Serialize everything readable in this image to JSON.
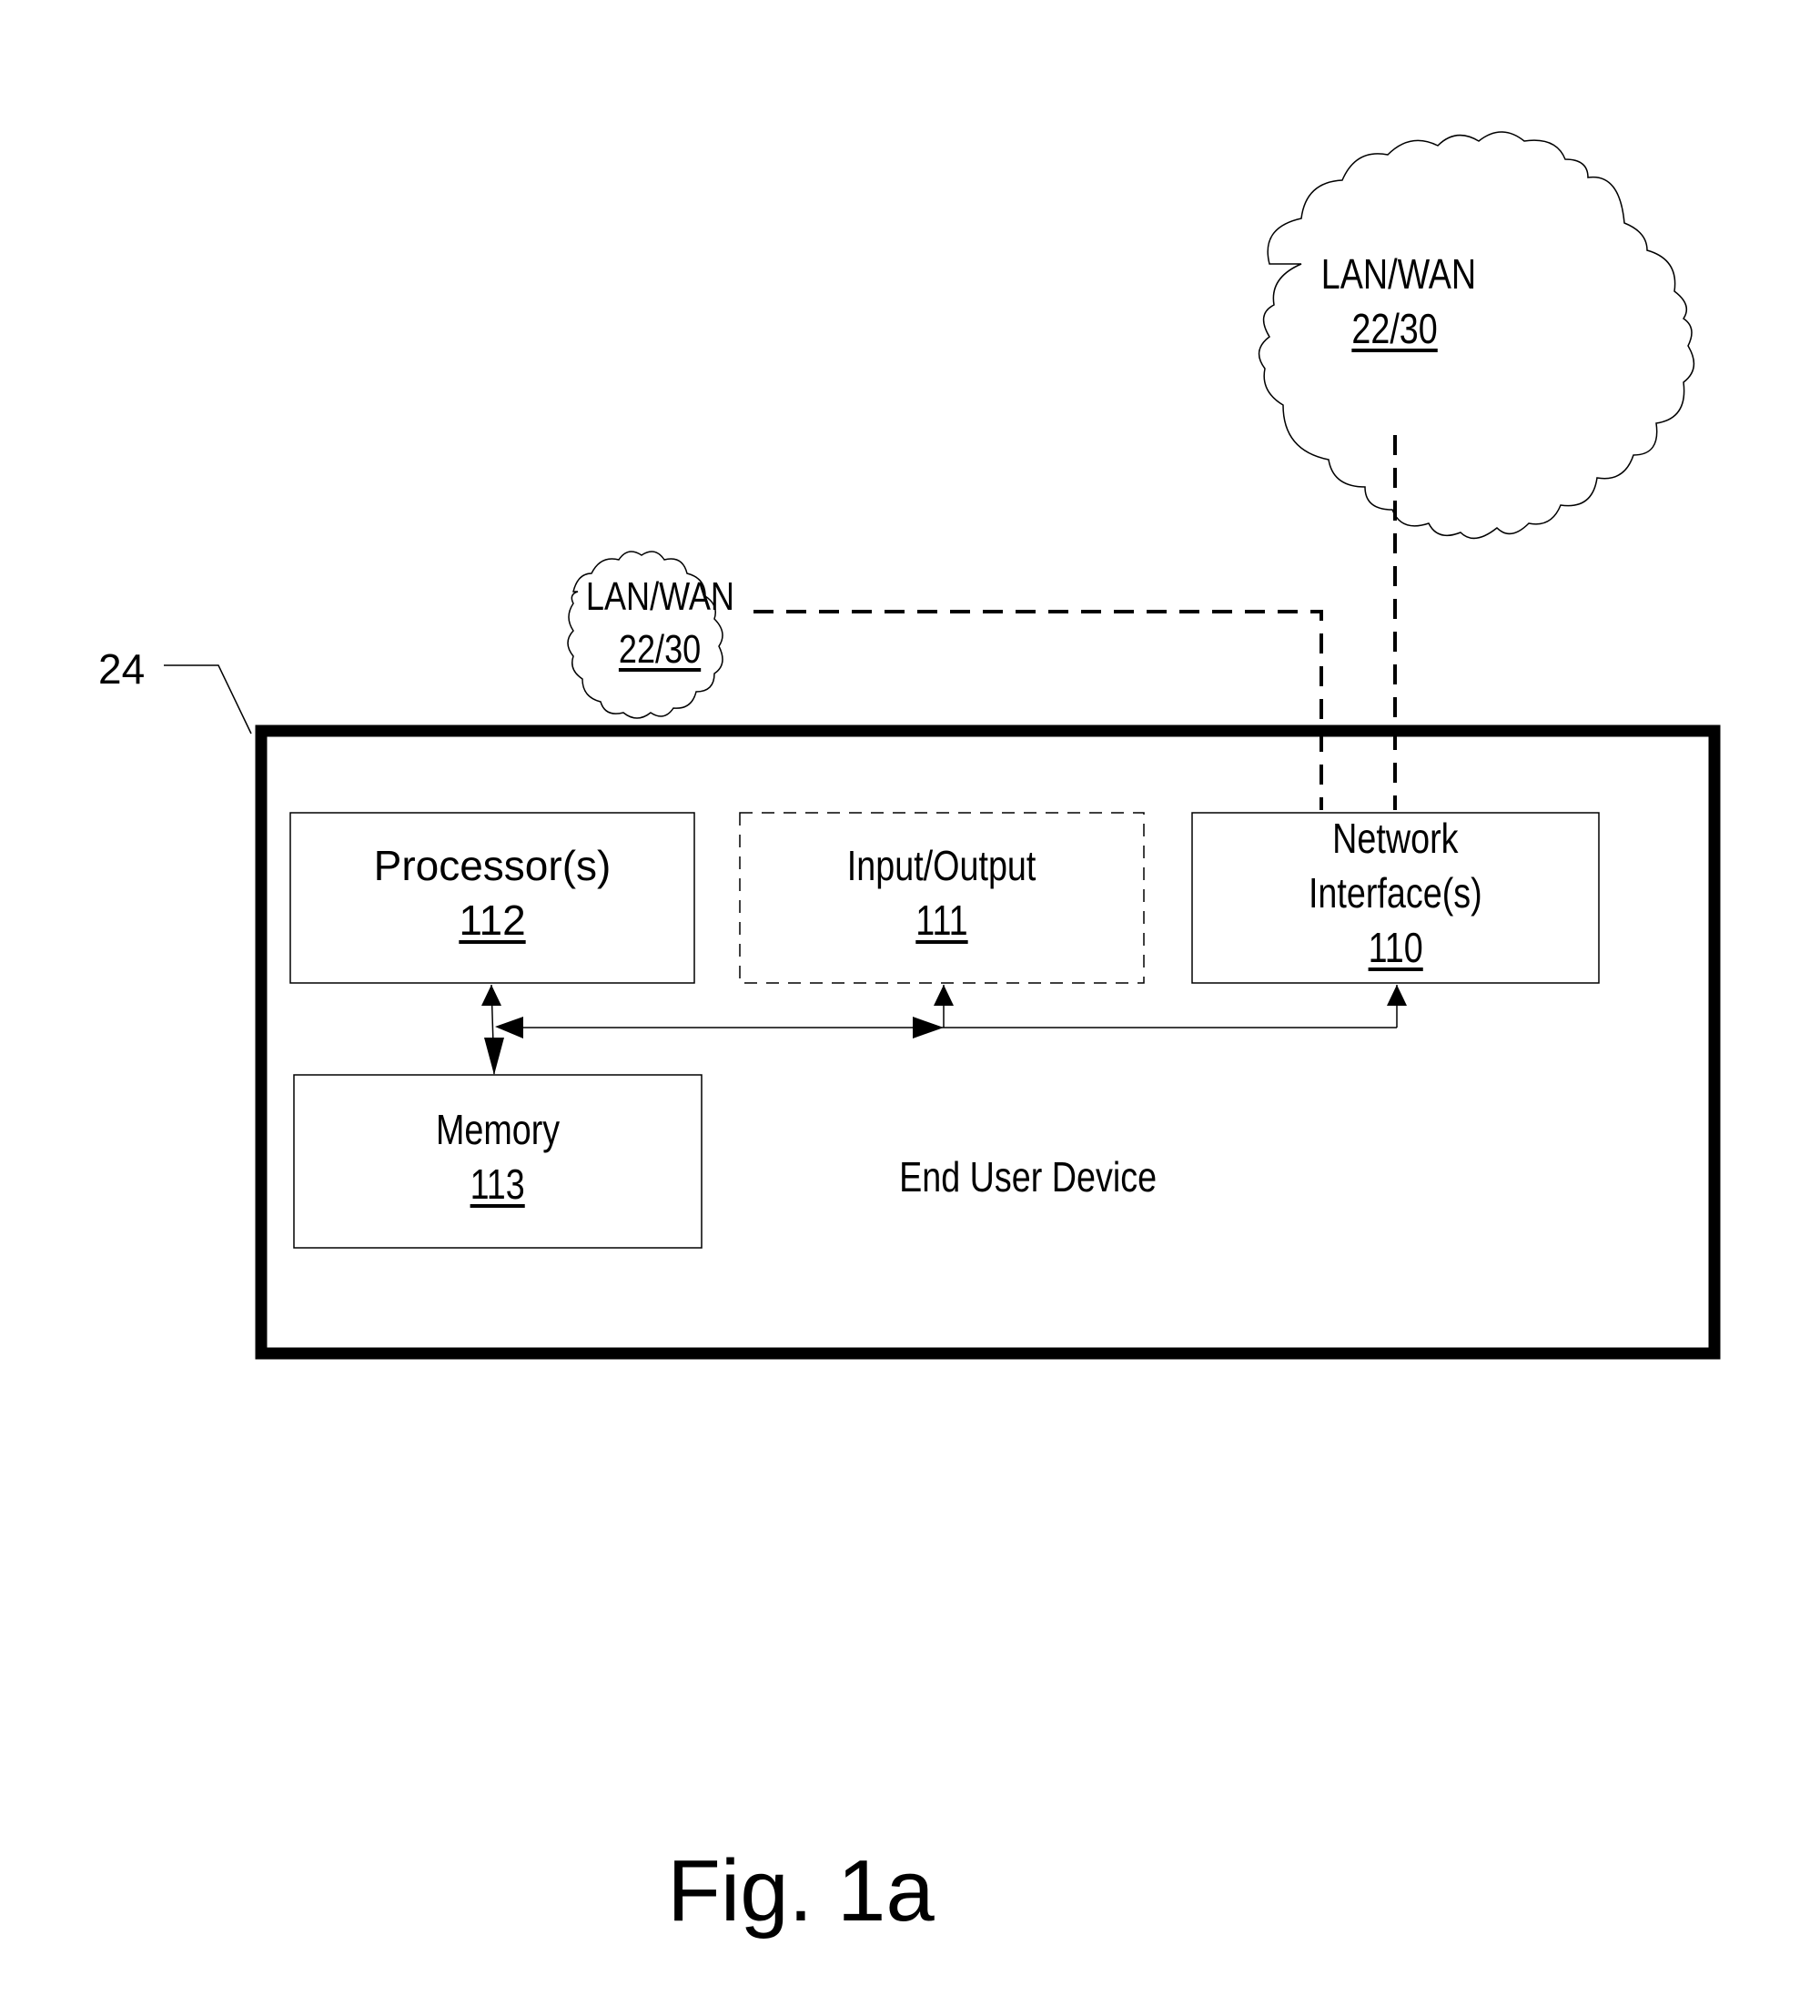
{
  "figure": {
    "caption": "Fig. 1a",
    "device_ref": "24",
    "device_label": "End User Device"
  },
  "networks": [
    {
      "name": "LAN/WAN",
      "ref": "22/30"
    },
    {
      "name": "LAN/WAN",
      "ref": "22/30"
    }
  ],
  "components": {
    "processor": {
      "name": "Processor(s)",
      "ref": "112"
    },
    "io": {
      "name": "Input/Output",
      "ref": "111",
      "optional": true
    },
    "network_interface": {
      "name_line1": "Network",
      "name_line2": "Interface(s)",
      "ref": "110"
    },
    "memory": {
      "name": "Memory",
      "ref": "113"
    }
  }
}
